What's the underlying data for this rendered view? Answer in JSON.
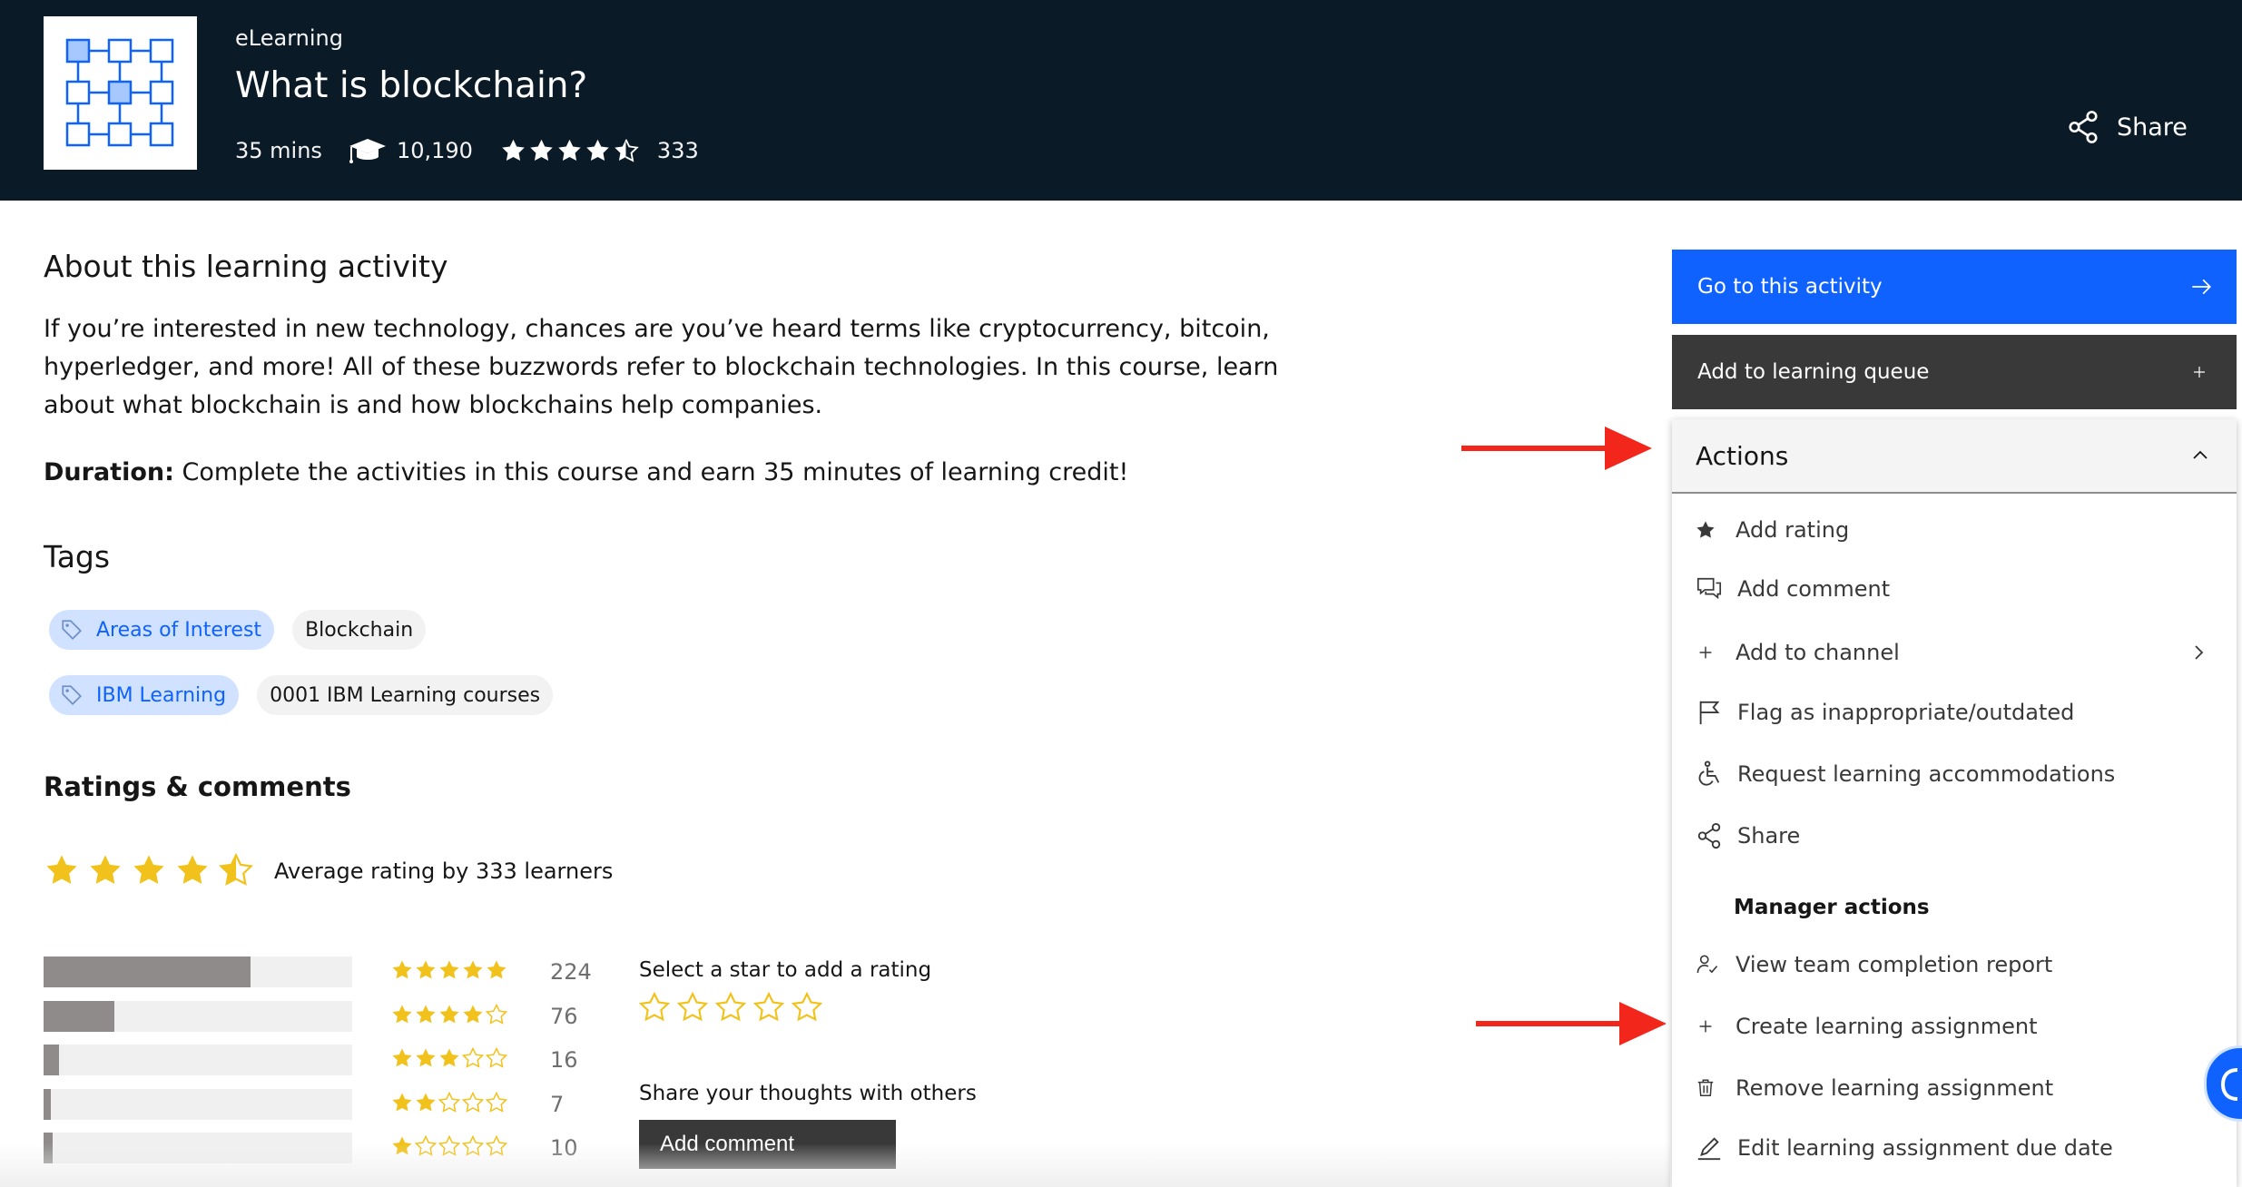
{
  "header": {
    "type_label": "eLearning",
    "title": "What is blockchain?",
    "duration": "35 mins",
    "learners_count": "10,190",
    "rating_count": "333",
    "share_label": "Share",
    "icons": {
      "thumbnail": "blockchain-grid-icon",
      "learners": "graduation-cap-icon",
      "share": "share-icon"
    }
  },
  "about": {
    "title": "About this learning activity",
    "description": "If you’re interested in new technology, chances are you’ve heard terms like cryptocurrency, bitcoin, hyperledger, and more! All of these buzzwords refer to blockchain technologies. In this course, learn about what blockchain is and how blockchains help companies.",
    "duration_label": "Duration:",
    "duration_text": " Complete the activities in this course and earn 35 minutes of learning credit!"
  },
  "tags": {
    "title": "Tags",
    "rows": [
      {
        "category": "Areas of Interest",
        "value": "Blockchain"
      },
      {
        "category": "IBM Learning",
        "value": "0001 IBM Learning courses"
      }
    ]
  },
  "ratings": {
    "title": "Ratings & comments",
    "average": 4.5,
    "average_text": "Average rating by 333 learners",
    "breakdown": [
      {
        "stars": 5,
        "count": "224",
        "fraction": 0.67
      },
      {
        "stars": 4,
        "count": "76",
        "fraction": 0.23
      },
      {
        "stars": 3,
        "count": "16",
        "fraction": 0.05
      },
      {
        "stars": 2,
        "count": "7",
        "fraction": 0.02
      },
      {
        "stars": 1,
        "count": "10",
        "fraction": 0.03
      }
    ],
    "select_label": "Select a star to add a rating",
    "share_thoughts": "Share your thoughts with others",
    "add_comment_label": "Add comment"
  },
  "sidebar": {
    "go_label": "Go to this activity",
    "queue_label": "Add to learning queue",
    "actions_label": "Actions",
    "items": [
      {
        "label": "Add rating",
        "icon": "star-icon"
      },
      {
        "label": "Add comment",
        "icon": "comment-icon"
      },
      {
        "label": "Add to channel",
        "icon": "plus-icon"
      },
      {
        "label": "Flag as inappropriate/outdated",
        "icon": "flag-icon"
      },
      {
        "label": "Request learning accommodations",
        "icon": "accessibility-icon"
      },
      {
        "label": "Share",
        "icon": "share-icon"
      }
    ],
    "manager_title": "Manager actions",
    "manager_items": [
      {
        "label": "View team completion report",
        "icon": "user-check-icon"
      },
      {
        "label": "Create learning assignment",
        "icon": "plus-icon"
      },
      {
        "label": "Remove learning assignment",
        "icon": "trash-icon"
      },
      {
        "label": "Edit learning assignment due date",
        "icon": "edit-icon"
      }
    ]
  },
  "colors": {
    "header_bg": "#0b1a27",
    "primary_blue": "#0f62fe",
    "dark_button": "#393939",
    "star_yellow": "#f1c21b",
    "annotation_red": "#f2261b",
    "tag_blue_bg": "#d0e2ff"
  }
}
